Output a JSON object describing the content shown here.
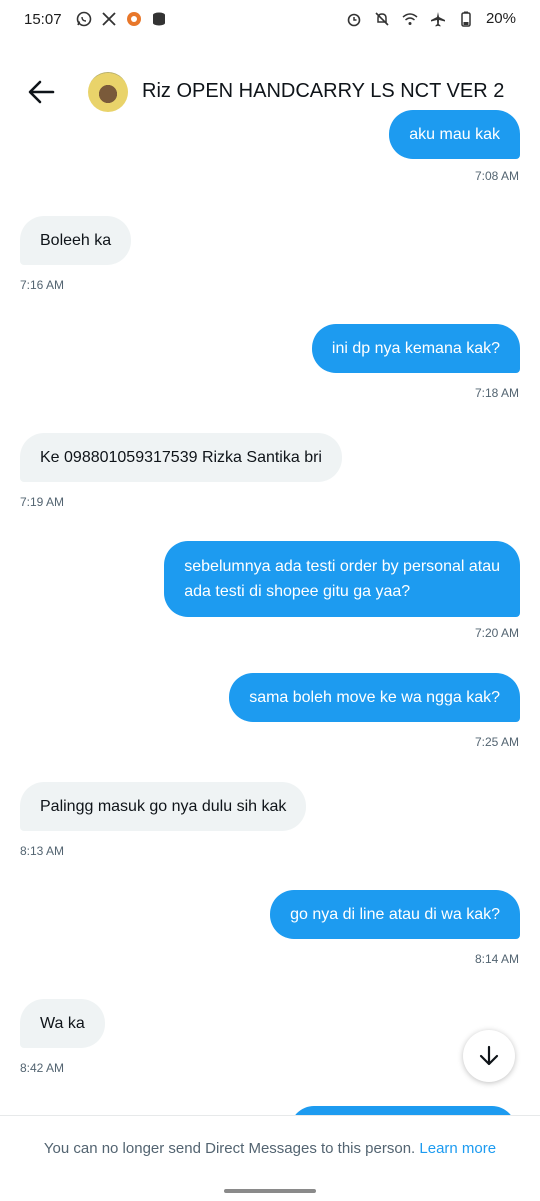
{
  "status_bar": {
    "time": "15:07",
    "battery": "20%"
  },
  "header": {
    "title": "Riz OPEN HANDCARRY LS NCT VER 2"
  },
  "messages": [
    {
      "text": "aku mau kak",
      "time": "7:08 AM",
      "direction": "out"
    },
    {
      "text": "Boleeh ka",
      "time": "7:16 AM",
      "direction": "in"
    },
    {
      "text": "ini dp nya kemana kak?",
      "time": "7:18 AM",
      "direction": "out"
    },
    {
      "text": "Ke 098801059317539 Rizka Santika bri",
      "time": "7:19 AM",
      "direction": "in"
    },
    {
      "line1": "sebelumnya ada testi order by personal atau",
      "line2": "ada testi di shopee gitu ga yaa?",
      "time": "7:20 AM",
      "direction": "out"
    },
    {
      "text": "sama boleh move ke wa ngga kak?",
      "time": "7:25 AM",
      "direction": "out"
    },
    {
      "text": "Palingg masuk go nya dulu sih kak",
      "time": "8:13 AM",
      "direction": "in"
    },
    {
      "text": "go nya di line atau di wa kak?",
      "time": "8:14 AM",
      "direction": "out"
    },
    {
      "text": "Wa ka",
      "time": "8:42 AM",
      "direction": "in"
    }
  ],
  "footer": {
    "notice": "You can no longer send Direct Messages to this person.",
    "learn_more": "Learn more"
  },
  "colors": {
    "accent": "#1d9bf0",
    "incoming_bubble": "#eff3f4",
    "muted_text": "#536471"
  },
  "icons": [
    "whatsapp-icon",
    "x-icon",
    "notification-badge-icon",
    "data-icon",
    "alarm-icon",
    "mute-icon",
    "wifi-icon",
    "airplane-icon",
    "battery-icon",
    "back-arrow-icon",
    "arrow-down-icon"
  ]
}
